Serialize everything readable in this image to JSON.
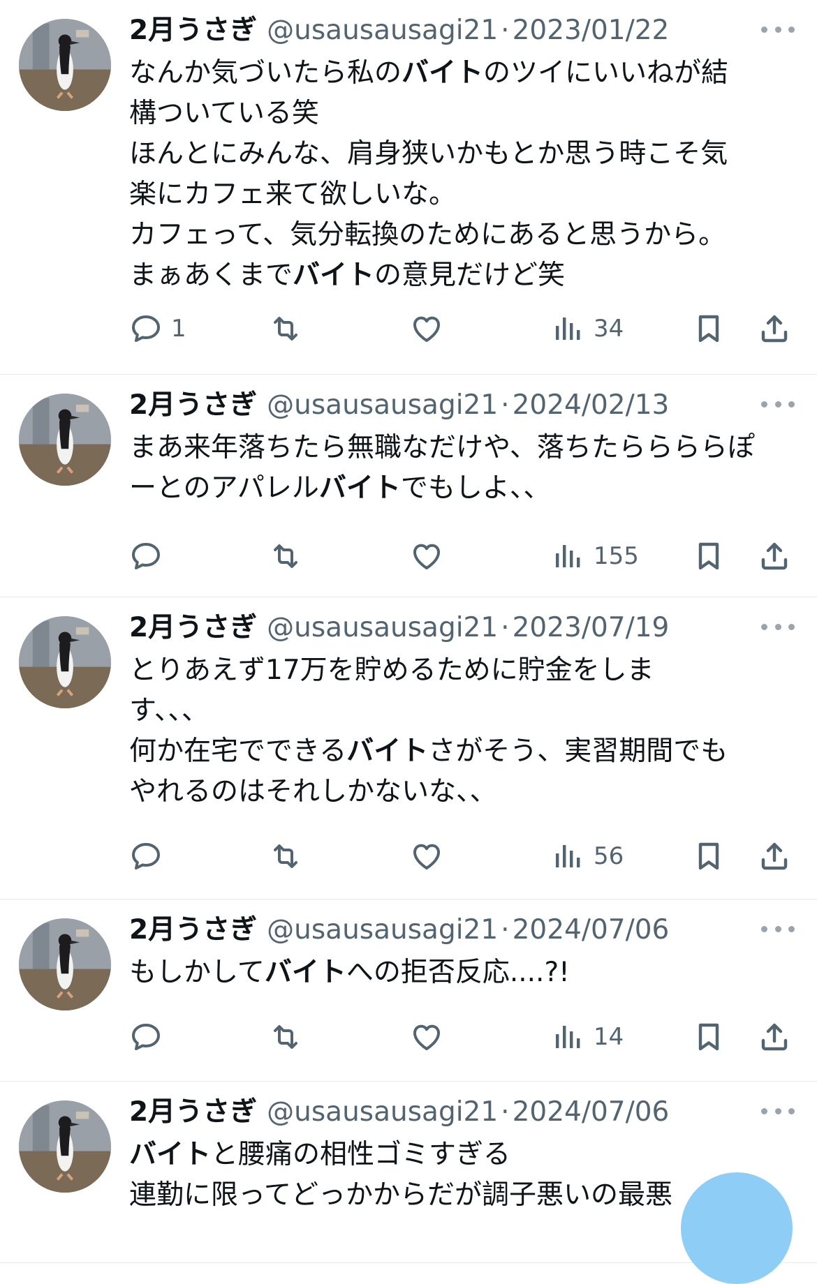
{
  "tweets": [
    {
      "name": "2月うさぎ",
      "handle": "@usausausagi21",
      "sep": "·",
      "date": "2023/01/22",
      "lines": [
        [
          {
            "t": "なんか気づいたら私の"
          },
          {
            "t": "バイト",
            "b": true
          },
          {
            "t": "のツイにいいねが結"
          }
        ],
        [
          {
            "t": "構ついている笑"
          }
        ],
        [
          {
            "t": "ほんとにみんな、肩身狭いかもとか思う時こそ気"
          }
        ],
        [
          {
            "t": "楽にカフェ来て欲しいな。"
          }
        ],
        [
          {
            "t": "カフェって、気分転換のためにあると思うから。"
          }
        ],
        [
          {
            "t": "まぁあくまで"
          },
          {
            "t": "バイト",
            "b": true
          },
          {
            "t": "の意見だけど笑"
          }
        ]
      ],
      "replies": "1",
      "views": "34"
    },
    {
      "name": "2月うさぎ",
      "handle": "@usausausagi21",
      "sep": "·",
      "date": "2024/02/13",
      "lines": [
        [
          {
            "t": "まあ来年落ちたら無職なだけや、落ちたららららぽ"
          }
        ],
        [
          {
            "t": "ーとのアパレル"
          },
          {
            "t": "バイト",
            "b": true
          },
          {
            "t": "でもしよ、、"
          }
        ]
      ],
      "replies": "",
      "views": "155"
    },
    {
      "name": "2月うさぎ",
      "handle": "@usausausagi21",
      "sep": "·",
      "date": "2023/07/19",
      "lines": [
        [
          {
            "t": "とりあえず17万を貯めるために貯金をしま"
          }
        ],
        [
          {
            "t": "す、、、"
          }
        ],
        [
          {
            "t": "何か在宅でできる"
          },
          {
            "t": "バイト",
            "b": true
          },
          {
            "t": "さがそう、実習期間でも"
          }
        ],
        [
          {
            "t": "やれるのはそれしかないな、、"
          }
        ]
      ],
      "replies": "",
      "views": "56"
    },
    {
      "name": "2月うさぎ",
      "handle": "@usausausagi21",
      "sep": "·",
      "date": "2024/07/06",
      "lines": [
        [
          {
            "t": "もしかして"
          },
          {
            "t": "バイト",
            "b": true
          },
          {
            "t": "への拒否反応....?!"
          }
        ]
      ],
      "replies": "",
      "views": "14"
    },
    {
      "name": "2月うさぎ",
      "handle": "@usausausagi21",
      "sep": "·",
      "date": "2024/07/06",
      "lines": [
        [
          {
            "t": "バイト",
            "b": true
          },
          {
            "t": "と腰痛の相性ゴミすぎる"
          }
        ],
        [
          {
            "t": "連勤に限ってどっかからだが調子悪いの最悪"
          }
        ]
      ],
      "replies": "",
      "views": ""
    }
  ],
  "icons": {
    "reply": "reply-bubble-icon",
    "retweet": "retweet-arrows-icon",
    "like": "heart-icon",
    "views": "bar-chart-icon",
    "bookmark": "bookmark-icon",
    "share": "share-upload-icon",
    "more": "more-dots-icon"
  },
  "colors": {
    "text": "#0f1419",
    "secondary": "#536471",
    "divider": "#e6e9ec",
    "fab": "#8ecdf5"
  }
}
